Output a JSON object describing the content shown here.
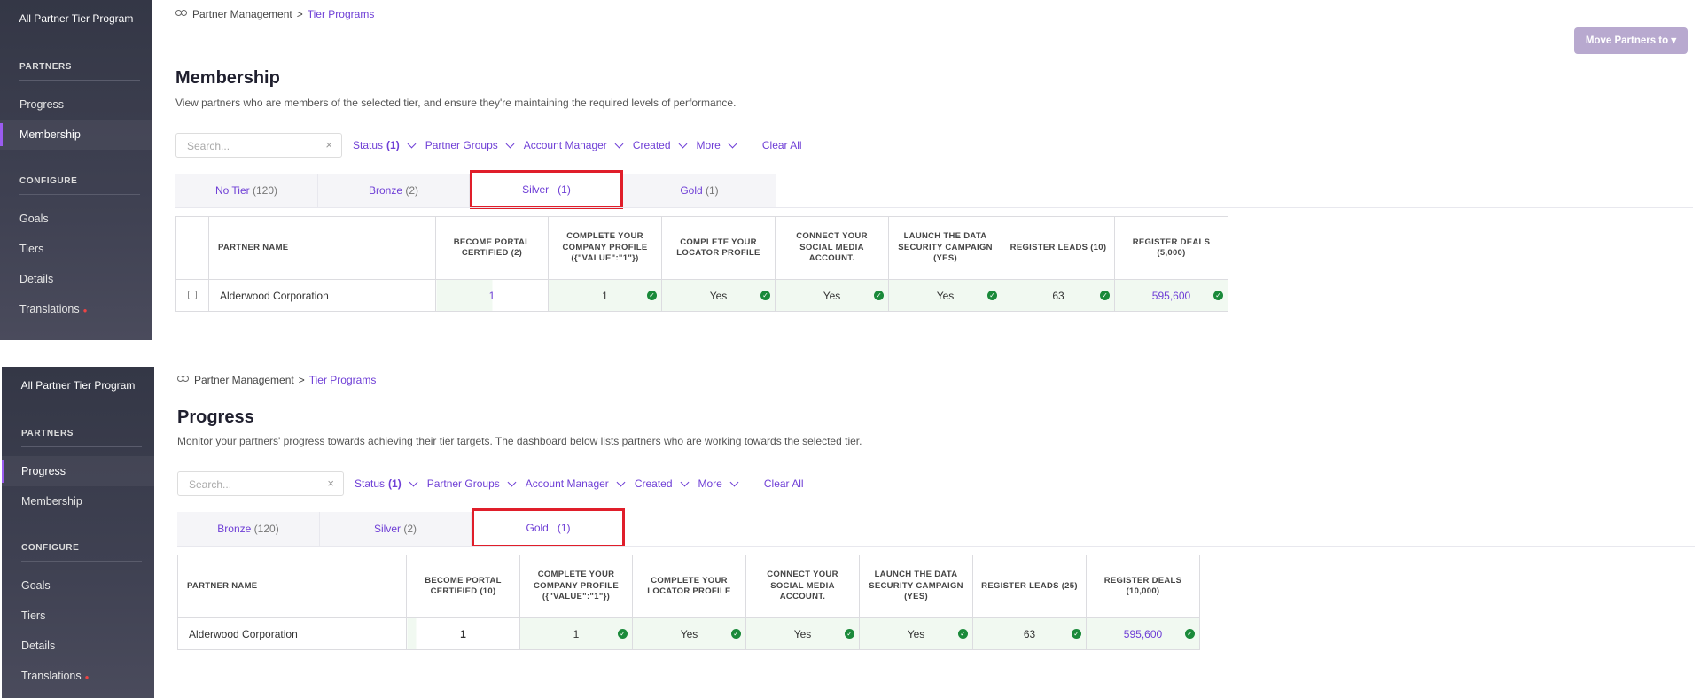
{
  "membership": {
    "sidebar": {
      "title": "All Partner Tier Program",
      "section_partners": "PARTNERS",
      "partners_items": [
        "Progress",
        "Membership"
      ],
      "section_configure": "CONFIGURE",
      "configure_items": [
        "Goals",
        "Tiers",
        "Details",
        "Translations"
      ]
    },
    "breadcrumb": {
      "root": "Partner Management",
      "sep": ">",
      "current": "Tier Programs"
    },
    "title": "Membership",
    "description": "View partners who are members of the selected tier, and ensure they're maintaining the required levels of performance.",
    "move_button": "Move Partners to ▾",
    "search_placeholder": "Search...",
    "filters": {
      "status": "Status",
      "status_count": "(1)",
      "partner_groups": "Partner Groups",
      "account_manager": "Account Manager",
      "created": "Created",
      "more": "More",
      "clear_all": "Clear All"
    },
    "tabs": [
      {
        "label": "No Tier",
        "count": "(120)"
      },
      {
        "label": "Bronze",
        "count": "(2)"
      },
      {
        "label": "Silver",
        "count": "(1)"
      },
      {
        "label": "Gold",
        "count": "(1)"
      }
    ],
    "columns": [
      "PARTNER NAME",
      "BECOME PORTAL CERTIFIED (2)",
      "COMPLETE YOUR COMPANY PROFILE ({\"VALUE\":\"1\"})",
      "COMPLETE YOUR LOCATOR PROFILE",
      "CONNECT YOUR SOCIAL MEDIA ACCOUNT.",
      "LAUNCH THE DATA SECURITY CAMPAIGN (YES)",
      "REGISTER LEADS (10)",
      "REGISTER DEALS (5,000)"
    ],
    "row": {
      "name": "Alderwood Corporation",
      "certified": "1",
      "profile": "1",
      "locator": "Yes",
      "social": "Yes",
      "campaign": "Yes",
      "leads": "63",
      "deals": "595,600"
    }
  },
  "progress": {
    "sidebar": {
      "title": "All Partner Tier Program",
      "section_partners": "PARTNERS",
      "partners_items": [
        "Progress",
        "Membership"
      ],
      "section_configure": "CONFIGURE",
      "configure_items": [
        "Goals",
        "Tiers",
        "Details",
        "Translations"
      ]
    },
    "breadcrumb": {
      "root": "Partner Management",
      "sep": ">",
      "current": "Tier Programs"
    },
    "title": "Progress",
    "description": "Monitor your partners' progress towards achieving their tier targets. The dashboard below lists partners who are working towards the selected tier.",
    "search_placeholder": "Search...",
    "filters": {
      "status": "Status",
      "status_count": "(1)",
      "partner_groups": "Partner Groups",
      "account_manager": "Account Manager",
      "created": "Created",
      "more": "More",
      "clear_all": "Clear All"
    },
    "tabs": [
      {
        "label": "Bronze",
        "count": "(120)"
      },
      {
        "label": "Silver",
        "count": "(2)"
      },
      {
        "label": "Gold",
        "count": "(1)"
      }
    ],
    "columns": [
      "PARTNER NAME",
      "BECOME PORTAL CERTIFIED (10)",
      "COMPLETE YOUR COMPANY PROFILE ({\"VALUE\":\"1\"})",
      "COMPLETE YOUR LOCATOR PROFILE",
      "CONNECT YOUR SOCIAL MEDIA ACCOUNT.",
      "LAUNCH THE DATA SECURITY CAMPAIGN (YES)",
      "REGISTER LEADS (25)",
      "REGISTER DEALS (10,000)"
    ],
    "row": {
      "name": "Alderwood Corporation",
      "certified": "1",
      "profile": "1",
      "locator": "Yes",
      "social": "Yes",
      "campaign": "Yes",
      "leads": "63",
      "deals": "595,600"
    }
  },
  "colors": {
    "accent": "#6f3fd6",
    "highlight": "#e01e2a",
    "success": "#1a8a3a",
    "sidebar": "#3a3c4c"
  }
}
